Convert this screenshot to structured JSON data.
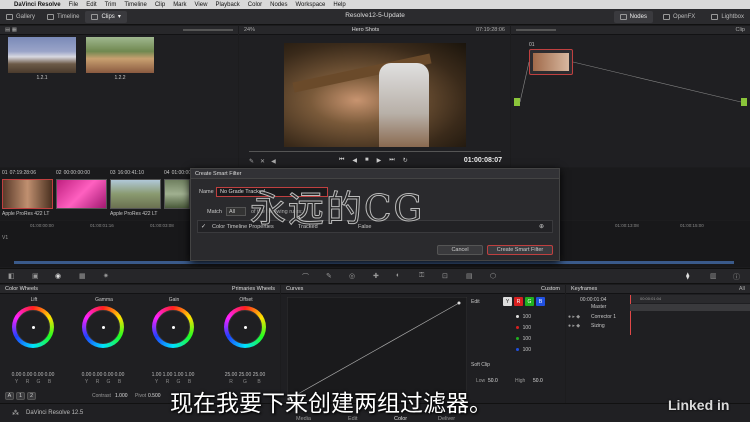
{
  "menubar": {
    "apple": "",
    "app": "DaVinci Resolve",
    "items": [
      "File",
      "Edit",
      "Trim",
      "Timeline",
      "Clip",
      "Mark",
      "View",
      "Playback",
      "Color",
      "Nodes",
      "Workspace",
      "Help"
    ]
  },
  "topbar": {
    "gallery": "Gallery",
    "timeline": "Timeline",
    "clips": "Clips",
    "title": "Resolve12-5-Update",
    "nodes": "Nodes",
    "openfx": "OpenFX",
    "lightbox": "Lightbox"
  },
  "viewer": {
    "zoom": "24%",
    "name": "Hero Shots",
    "timecode": "07:19:28:06",
    "playhead": "01:00:08:07"
  },
  "gallery": {
    "stills": [
      {
        "label": "1.2.1"
      },
      {
        "label": "1.2.2"
      }
    ]
  },
  "nodes": {
    "header": "Clip",
    "node_label": "01"
  },
  "timeline": {
    "clips": [
      {
        "num": "01",
        "tc": "07:19:28:06",
        "codec": "Apple ProRes 422 LT"
      },
      {
        "num": "02",
        "tc": "00:00:00:00",
        "codec": "Apple ProRes 422 LT"
      },
      {
        "num": "03",
        "tc": "16:00:41:10",
        "codec": "Apple ProRes 422 LT"
      },
      {
        "num": "04",
        "tc": "01:00:00:0",
        "codec": ""
      }
    ],
    "ruler": [
      "01:00:00:00",
      "01:00:01:16",
      "01:00:03:08",
      "01:00:05:00",
      "01:00:13:08",
      "01:00:15:00"
    ],
    "track": "V1"
  },
  "dialog": {
    "title": "Create Smart Filter",
    "name_label": "Name",
    "name_value": "No Grade Tracked",
    "match_label": "Match",
    "match_value": "All",
    "match_tail": "of the following rules:",
    "rule_field": "Color Timeline Properties",
    "rule_op": "Tracked",
    "rule_value": "False",
    "cancel": "Cancel",
    "create": "Create Smart Filter"
  },
  "watermark": "永远的CG",
  "color": {
    "wheels_title": "Color Wheels",
    "primaries": "Primaries Wheels",
    "curves": "Curves",
    "custom": "Custom",
    "keyframes": "Keyframes",
    "keyframes_filter": "All",
    "kf_timecode": "00:00:01:04",
    "kf_ruler": "00:00:01:04",
    "kf_rows": [
      "Master",
      "Corrector 1",
      "Sizing"
    ],
    "wheels": [
      {
        "name": "Lift",
        "vals": [
          "0.00",
          "0.00",
          "0.00",
          "0.00"
        ]
      },
      {
        "name": "Gamma",
        "vals": [
          "0.00",
          "0.00",
          "0.00",
          "0.00"
        ]
      },
      {
        "name": "Gain",
        "vals": [
          "1.00",
          "1.00",
          "1.00",
          "1.00"
        ]
      },
      {
        "name": "Offset",
        "vals": [
          "25.00",
          "25.00",
          "25.00",
          ""
        ]
      }
    ],
    "wheel_channels": [
      "Y",
      "R",
      "G",
      "B"
    ],
    "contrast_label": "Contrast",
    "contrast": "1.000",
    "pivot_label": "Pivot",
    "pivot": "0.500",
    "edit_label": "Edit",
    "curve_vals": [
      "100",
      "100",
      "100",
      "100"
    ],
    "soft_clip": "Soft Clip",
    "low_label": "Low",
    "low": "50.0",
    "high_label": "High",
    "high": "50.0"
  },
  "pages": [
    "Media",
    "Edit",
    "Color",
    "Deliver"
  ],
  "version": "DaVinci Resolve 12.5",
  "subtitle": "现在我要下来创建两组过滤器。",
  "brand": "Linked in",
  "ab": [
    "A",
    "1",
    "2"
  ],
  "colors": {
    "accent": "#e04848",
    "red": "#d82020",
    "green": "#20b020",
    "blue": "#2050e0"
  }
}
